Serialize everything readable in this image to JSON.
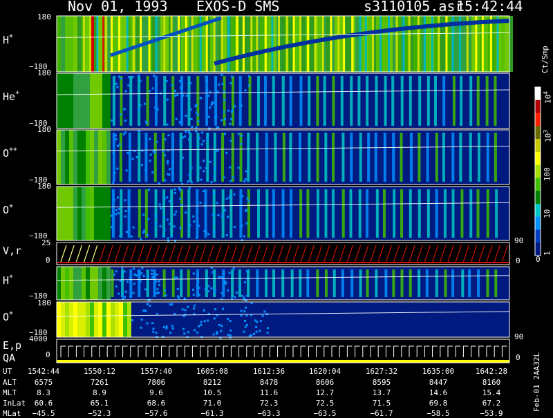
{
  "header": {
    "date": "Nov 01, 1993",
    "instrument": "EXOS-D SMS",
    "file": "s3110105.asr",
    "time": "15:42:44"
  },
  "panels": [
    {
      "label": "H",
      "charge": "+",
      "top_tick": "180",
      "bottom_tick": "−180"
    },
    {
      "label": "He",
      "charge": "+",
      "top_tick": "180",
      "bottom_tick": "−180"
    },
    {
      "label": "O",
      "charge": "++",
      "top_tick": "180",
      "bottom_tick": "−180"
    },
    {
      "label": "O",
      "charge": "+",
      "top_tick": "180",
      "bottom_tick": "−180"
    },
    {
      "label": "V,r",
      "charge": "",
      "top_tick": "25",
      "bottom_tick": "0"
    },
    {
      "label": "H",
      "charge": "+",
      "top_tick": "180",
      "bottom_tick": "−180"
    },
    {
      "label": "O",
      "charge": "+",
      "top_tick": "180",
      "bottom_tick": "−180"
    },
    {
      "label": "E,p",
      "charge": "",
      "top_tick": "4000",
      "bottom_tick": "0"
    }
  ],
  "qa_label": "QA",
  "right_ticks": {
    "a": "90",
    "b": "0",
    "c": "90",
    "d": "0"
  },
  "colorbar": {
    "unit": "Ct/Smp",
    "labels": [
      {
        "base": "10",
        "exp": "4"
      },
      {
        "base": "10",
        "exp": "3"
      },
      {
        "base": "100",
        "exp": ""
      },
      {
        "base": "10",
        "exp": ""
      },
      {
        "base": "1",
        "exp": ""
      },
      {
        "base": "0",
        "exp": ""
      }
    ],
    "colors": [
      "#ffffff",
      "#b00000",
      "#ff2000",
      "#6a6a00",
      "#c8c800",
      "#ffff00",
      "#a8e000",
      "#40c000",
      "#008000",
      "#00c8c8",
      "#0090ff",
      "#0040c0",
      "#001a80"
    ]
  },
  "table": {
    "row_labels": [
      "UT",
      "ALT",
      "MLT",
      "InLat",
      "MLat"
    ],
    "columns": [
      [
        "1542:44",
        "6575",
        "8.3",
        "60.6",
        "−45.5"
      ],
      [
        "1550:12",
        "7261",
        "8.9",
        "65.1",
        "−52.3"
      ],
      [
        "1557:40",
        "7806",
        "9.6",
        "68.6",
        "−57.6"
      ],
      [
        "1605:08",
        "8212",
        "10.5",
        "71.0",
        "−61.3"
      ],
      [
        "1612:36",
        "8478",
        "11.6",
        "72.3",
        "−63.3"
      ],
      [
        "1620:04",
        "8606",
        "12.7",
        "72.5",
        "−63.5"
      ],
      [
        "1627:32",
        "8595",
        "13.7",
        "71.5",
        "−61.7"
      ],
      [
        "1635:00",
        "8447",
        "14.6",
        "69.8",
        "−58.5"
      ],
      [
        "1642:28",
        "8160",
        "15.4",
        "67.2",
        "−53.9"
      ]
    ]
  },
  "footer": "Feb-01 2AA32L",
  "chart_data": {
    "type": "heatmap",
    "title": "Nov 01, 1993   EXOS-D SMS",
    "x": [
      "1542:44",
      "1550:12",
      "1557:40",
      "1605:08",
      "1612:36",
      "1620:04",
      "1627:32",
      "1635:00",
      "1642:28"
    ],
    "panels": [
      "H+",
      "He+",
      "O++",
      "O+",
      "V,r",
      "H+",
      "O+",
      "E,p"
    ],
    "ylim_pitch": [
      -180,
      180
    ],
    "ylim_vr": [
      0,
      25
    ],
    "ylim_ep": [
      0,
      4000
    ],
    "colorbar_unit": "Ct/Smp",
    "colorbar_ticks": [
      "10^4",
      "10^3",
      "100",
      "10",
      "1",
      "0"
    ]
  }
}
